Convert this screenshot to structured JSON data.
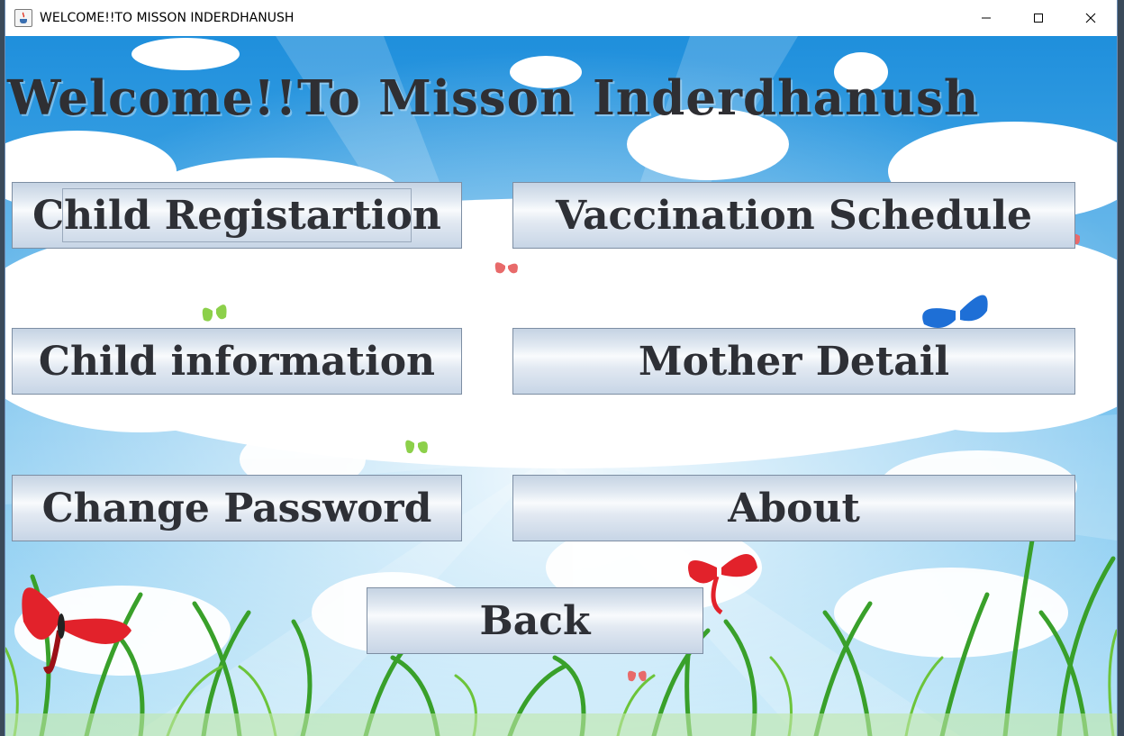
{
  "window": {
    "title": "WELCOME!!TO MISSON INDERDHANUSH",
    "controls": [
      "minimize",
      "maximize",
      "close"
    ]
  },
  "main": {
    "heading": "Welcome!!To Misson Inderdhanush",
    "buttons": {
      "child_registration": "Child Registartion",
      "vaccination_schedule": "Vaccination Schedule",
      "child_information": "Child information",
      "mother_detail": "Mother Detail",
      "change_password": "Change Password",
      "about": "About",
      "back": "Back"
    }
  },
  "colors": {
    "sky_top": "#1f8fdc",
    "sky_mid": "#7ccbf0",
    "grass": "#3aa52a",
    "button_text": "#2e3036",
    "heading_text": "#2f2f33"
  }
}
